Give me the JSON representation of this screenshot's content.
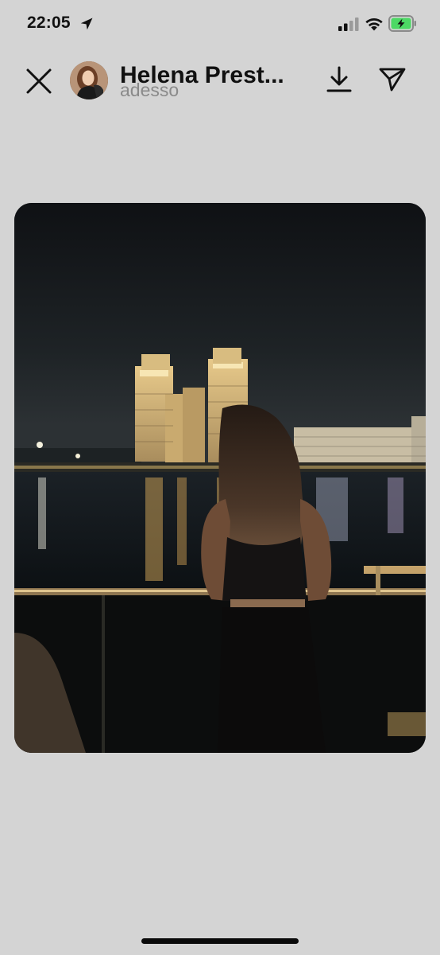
{
  "status_bar": {
    "time": "22:05",
    "icons": [
      "location-arrow-icon",
      "cellular-signal-icon",
      "wifi-icon",
      "battery-charging-icon"
    ]
  },
  "header": {
    "user_name": "Helena Prest...",
    "post_time": "adesso",
    "icons": [
      "close-icon",
      "download-icon",
      "send-icon"
    ]
  },
  "story": {
    "image_subject": "night skyline over river with woman on balcony"
  },
  "colors": {
    "background": "#d4d4d4",
    "text_primary": "#111111",
    "text_secondary": "#8a8a8a",
    "battery_fill": "#4cd964"
  }
}
